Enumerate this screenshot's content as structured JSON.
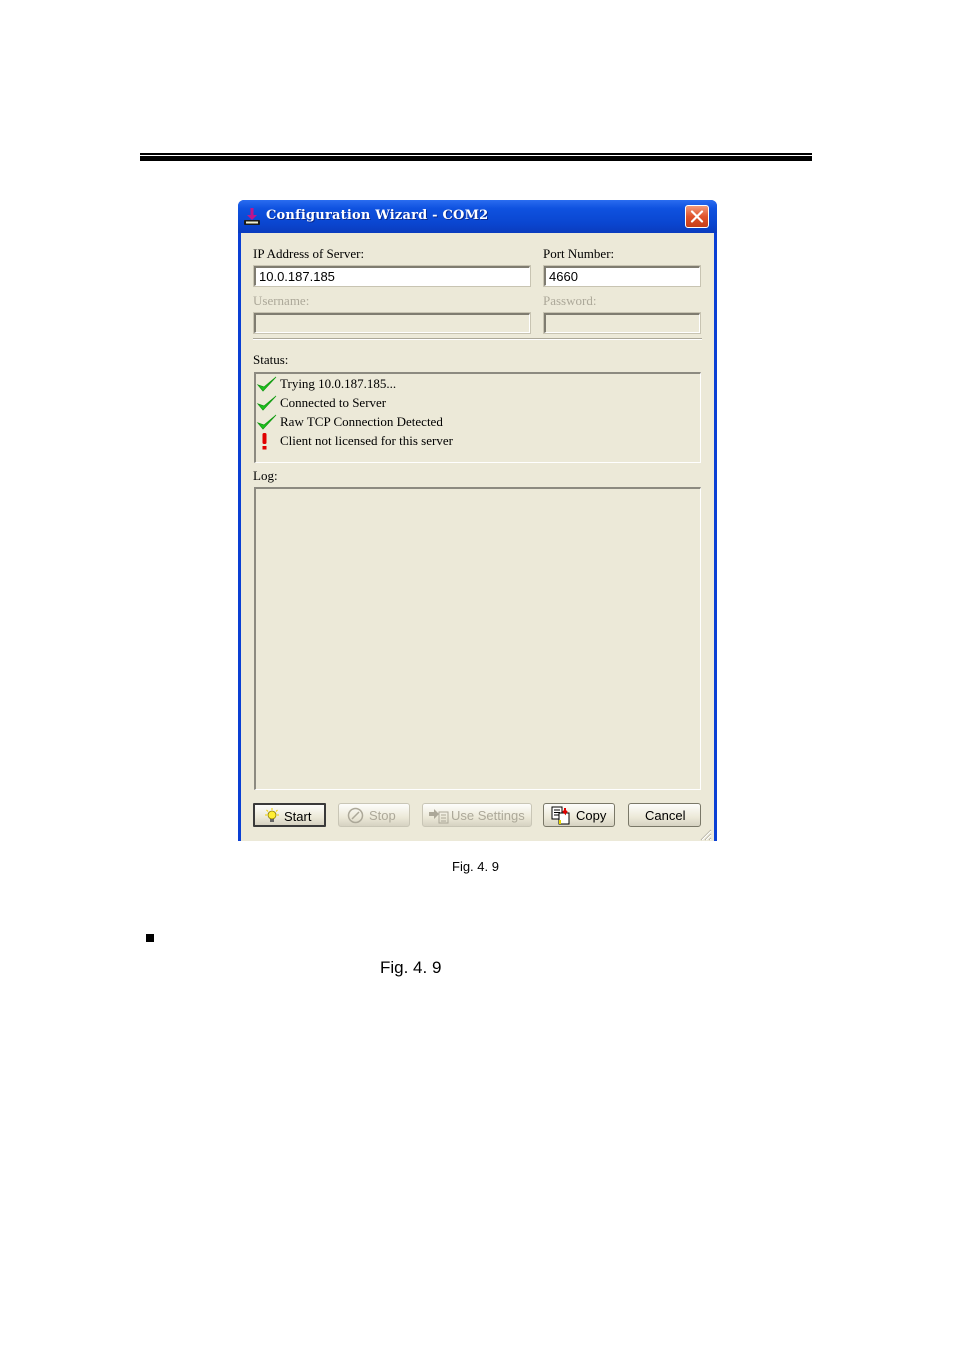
{
  "document": {
    "figure_caption": "Fig. 4. 9",
    "body_reference": "Fig. 4. 9"
  },
  "window": {
    "title": "Configuration Wizard - COM2",
    "app_icon": "printer-download-icon",
    "close_icon": "close-icon"
  },
  "form": {
    "ip_label": "IP Address of Server:",
    "ip_value": "10.0.187.185",
    "port_label": "Port Number:",
    "port_value": "4660",
    "username_label": "Username:",
    "username_value": "",
    "password_label": "Password:",
    "password_value": ""
  },
  "status": {
    "label": "Status:",
    "items": [
      {
        "icon": "check-icon",
        "text": "Trying 10.0.187.185...",
        "color": "#1fc21f"
      },
      {
        "icon": "check-icon",
        "text": "Connected to Server",
        "color": "#1fc21f"
      },
      {
        "icon": "check-icon",
        "text": "Raw TCP Connection Detected",
        "color": "#1fc21f"
      },
      {
        "icon": "exclamation-icon",
        "text": "Client not licensed for this server",
        "color": "#e00000"
      }
    ]
  },
  "log": {
    "label": "Log:",
    "content": ""
  },
  "buttons": {
    "start": {
      "label": "Start",
      "icon": "lightbulb-icon",
      "enabled": true
    },
    "stop": {
      "label": "Stop",
      "icon": "stop-icon",
      "enabled": false
    },
    "use_settings": {
      "label": "Use Settings",
      "icon": "use-settings-icon",
      "enabled": false
    },
    "copy": {
      "label": "Copy",
      "icon": "copy-icon",
      "enabled": true
    },
    "cancel": {
      "label": "Cancel",
      "enabled": true
    }
  }
}
